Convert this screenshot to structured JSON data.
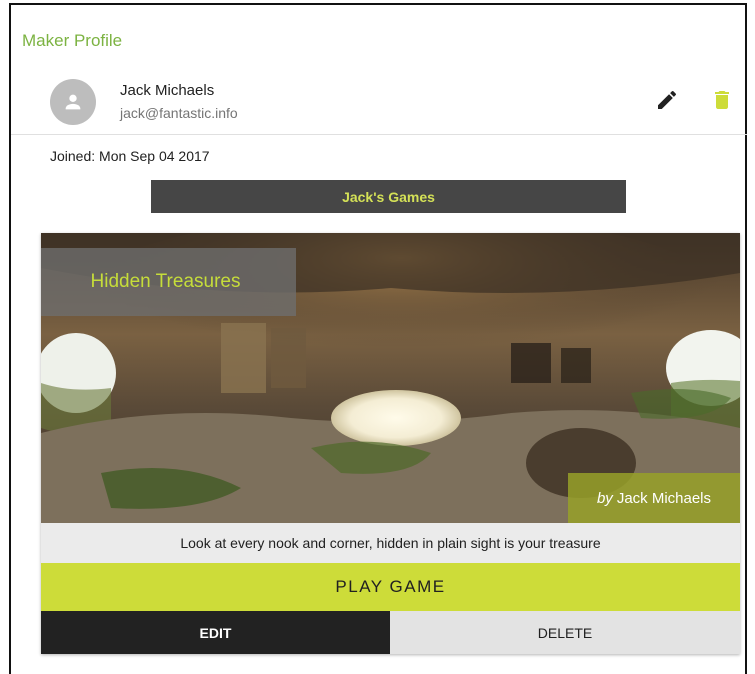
{
  "page": {
    "title": "Maker Profile"
  },
  "user": {
    "name": "Jack Michaels",
    "email": "jack@fantastic.info",
    "joined": "Joined: Mon Sep 04 2017"
  },
  "icons": {
    "avatar": "person-icon",
    "edit": "pencil-icon",
    "delete": "trash-icon"
  },
  "colors": {
    "accent_green": "#7cb342",
    "lime": "#cddc39",
    "delete_icon": "#cddc39",
    "games_bar": "#464646"
  },
  "games_section": {
    "title": "Jack's Games"
  },
  "game_card": {
    "title": "Hidden Treasures",
    "author_prefix": "by",
    "author": "Jack Michaels",
    "description": "Look at every nook and corner, hidden in plain sight is your treasure",
    "play_label": "PLAY GAME",
    "edit_label": "EDIT",
    "delete_label": "DELETE"
  }
}
